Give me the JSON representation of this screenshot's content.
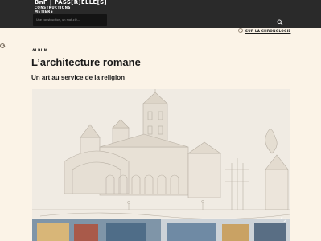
{
  "header": {
    "logo_main": "BnF | PASS[R]ELLE[S]",
    "logo_line1": "CONSTRUCTIONS",
    "logo_line2": "MÉTIERS",
    "search_placeholder": "Une construction, un mot-clé..."
  },
  "chronology_link": "SUR LA CHRONOLOGIE",
  "album": {
    "category": "ALBUM",
    "title": "L’architecture romane",
    "subtitle": "Un art au service de la religion"
  },
  "icons": {
    "search": "search-icon",
    "chronology": "clock-icon",
    "side": "chevron-circle-icon",
    "expand": "expand-icon"
  },
  "colors": {
    "header_bg": "#2a2a2a",
    "page_bg": "#fbf3e7",
    "text": "#1a1a1a"
  }
}
